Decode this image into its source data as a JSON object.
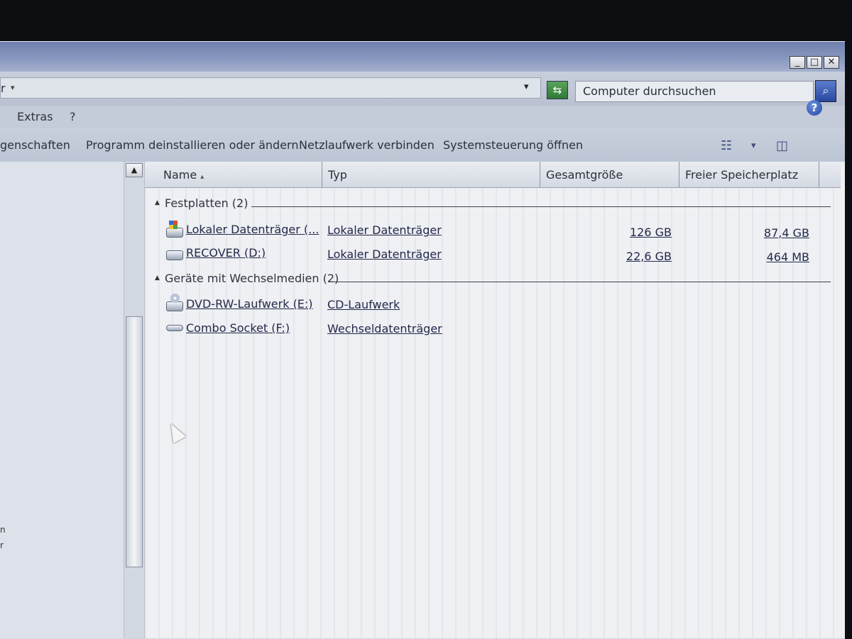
{
  "window": {
    "controls": {
      "minimize": "_",
      "maximize": "□",
      "close": "✕"
    }
  },
  "address": {
    "fragment": "r",
    "fragment_arrow": "▾",
    "dropdown": "▾",
    "refresh_icon": "refresh-icon",
    "search_placeholder": "Computer durchsuchen",
    "search_icon": "search-icon"
  },
  "menu": {
    "items": [
      "Extras",
      "?"
    ]
  },
  "toolbar": {
    "properties": "genschaften",
    "uninstall": "Programm deinstallieren oder ändern",
    "map_drive": "Netzlaufwerk verbinden",
    "control_panel": "Systemsteuerung öffnen",
    "view_dropdown": "▾",
    "help": "?"
  },
  "nav": {
    "fragments": [
      "n",
      "r"
    ]
  },
  "columns": {
    "name": "Name",
    "sort_arrow": "▴",
    "type": "Typ",
    "total": "Gesamtgröße",
    "free": "Freier Speicherplatz"
  },
  "groups": [
    {
      "title": "Festplatten (2)",
      "items": [
        {
          "name": "Lokaler Datenträger (...",
          "type": "Lokaler Datenträger",
          "total": "126 GB",
          "free": "87,4 GB",
          "icon": "windows-drive-icon"
        },
        {
          "name": "RECOVER (D:)",
          "type": "Lokaler Datenträger",
          "total": "22,6 GB",
          "free": "464 MB",
          "icon": "hard-drive-icon"
        }
      ]
    },
    {
      "title": "Geräte mit Wechselmedien (2)",
      "items": [
        {
          "name": "DVD-RW-Laufwerk (E:)",
          "type": "CD-Laufwerk",
          "total": "",
          "free": "",
          "icon": "dvd-drive-icon"
        },
        {
          "name": "Combo Socket (F:)",
          "type": "Wechseldatenträger",
          "total": "",
          "free": "",
          "icon": "removable-drive-icon"
        }
      ]
    }
  ]
}
